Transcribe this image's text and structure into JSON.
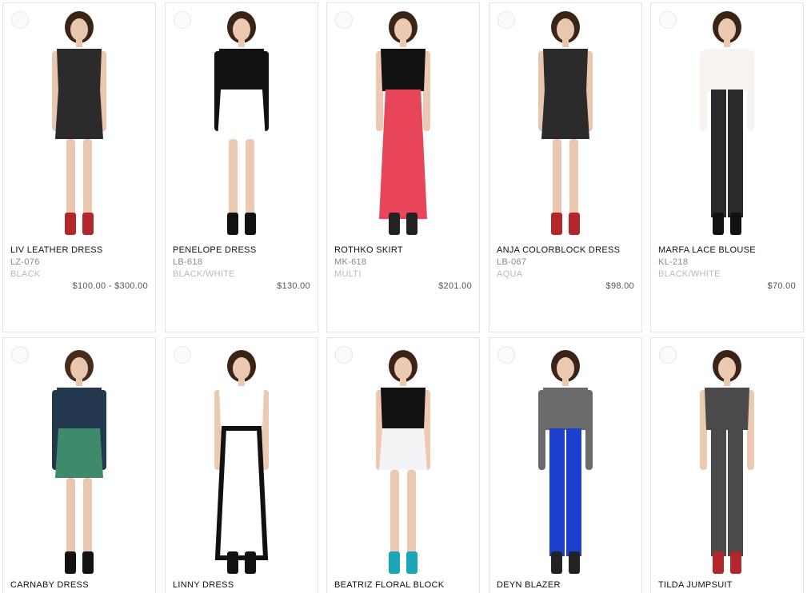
{
  "products": [
    {
      "name": "LIV LEATHER DRESS",
      "sku": "LZ-076",
      "color": "BLACK",
      "price": "$100.00 - $300.00",
      "skin": "#e9c6ad",
      "hair": "#3a2418",
      "top": "#2b2b2b",
      "bottom": "#2b2b2b",
      "shoes": "#b3262a",
      "legs": "bare",
      "style": "tunic"
    },
    {
      "name": "PENELOPE DRESS",
      "sku": "LB-618",
      "color": "BLACK/WHITE",
      "price": "$130.00",
      "skin": "#ecc9b1",
      "hair": "#3a2418",
      "top": "#111111",
      "bottom": "#ffffff",
      "shoes": "#111111",
      "legs": "bare",
      "style": "shift"
    },
    {
      "name": "ROTHKO SKIRT",
      "sku": "MK-618",
      "color": "MULTI",
      "price": "$201.00",
      "skin": "#ecc9b1",
      "hair": "#3a2418",
      "top": "#111111",
      "bottom": "#e8455a",
      "shoes": "#222222",
      "legs": "maxi",
      "style": "maxi"
    },
    {
      "name": "ANJA COLORBLOCK DRESS",
      "sku": "LB-067",
      "color": "AQUA",
      "price": "$98.00",
      "skin": "#e9c6ad",
      "hair": "#3a2418",
      "top": "#2b2b2b",
      "bottom": "#2b2b2b",
      "shoes": "#b3262a",
      "legs": "bare",
      "style": "tunic"
    },
    {
      "name": "MARFA LACE BLOUSE",
      "sku": "KL-218",
      "color": "BLACK/WHITE",
      "price": "$70.00",
      "skin": "#ecc9b1",
      "hair": "#3a2418",
      "top": "#f6f3f1",
      "bottom": "#2a2a2a",
      "shoes": "#111111",
      "legs": "pants",
      "style": "blouse"
    },
    {
      "name": "CARNABY DRESS",
      "sku": "",
      "color": "",
      "price": "",
      "skin": "#e9c6ad",
      "hair": "#4a2a1c",
      "top": "#23384f",
      "bottom": "#3f8a6a",
      "shoes": "#111111",
      "legs": "bare",
      "style": "shift"
    },
    {
      "name": "LINNY DRESS",
      "sku": "",
      "color": "",
      "price": "",
      "skin": "#ecc9b1",
      "hair": "#3a2418",
      "top": "#ffffff",
      "bottom": "#ffffff",
      "shoes": "#111111",
      "legs": "maxi",
      "style": "column"
    },
    {
      "name": "BEATRIZ FLORAL BLOCK",
      "sku": "",
      "color": "",
      "price": "",
      "skin": "#ecc9b1",
      "hair": "#3a2418",
      "top": "#111111",
      "bottom": "#f3f3f6",
      "shoes": "#1aa6b7",
      "legs": "bare",
      "style": "mini"
    },
    {
      "name": "DEYN BLAZER",
      "sku": "",
      "color": "",
      "price": "",
      "skin": "#ecc9b1",
      "hair": "#3a2418",
      "top": "#6a6a6a",
      "bottom": "#1b3fcf",
      "shoes": "#222222",
      "legs": "pants",
      "style": "blazer"
    },
    {
      "name": "TILDA JUMPSUIT",
      "sku": "",
      "color": "",
      "price": "",
      "skin": "#ecc9b1",
      "hair": "#3a2418",
      "top": "#4a4a4a",
      "bottom": "#4a4a4a",
      "shoes": "#b3262a",
      "legs": "pants",
      "style": "jumpsuit"
    }
  ]
}
